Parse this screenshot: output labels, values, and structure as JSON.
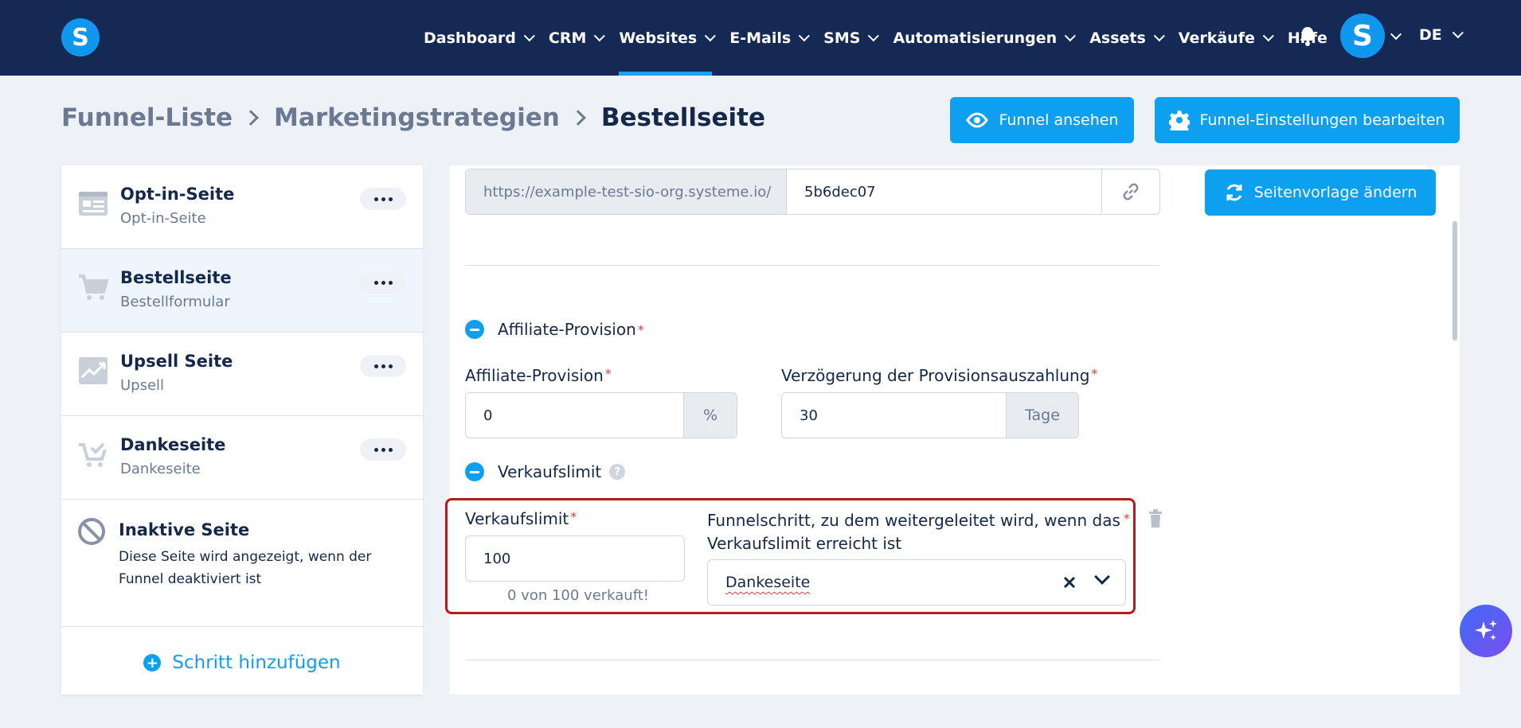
{
  "nav": {
    "logo_letter": "S",
    "items": [
      {
        "label": "Dashboard",
        "dropdown": true
      },
      {
        "label": "CRM",
        "dropdown": true
      },
      {
        "label": "Websites",
        "dropdown": true,
        "active": true
      },
      {
        "label": "E-Mails",
        "dropdown": true
      },
      {
        "label": "SMS",
        "dropdown": true
      },
      {
        "label": "Automatisierungen",
        "dropdown": true
      },
      {
        "label": "Assets",
        "dropdown": true
      },
      {
        "label": "Verkäufe",
        "dropdown": true
      },
      {
        "label": "Hilfe",
        "dropdown": false
      }
    ],
    "avatar_letter": "S",
    "language": "DE"
  },
  "breadcrumb": {
    "items": [
      "Funnel-Liste",
      "Marketingstrategien",
      "Bestellseite"
    ]
  },
  "header_buttons": {
    "view_funnel": "Funnel ansehen",
    "edit_settings": "Funnel-Einstellungen bearbeiten"
  },
  "sidebar": {
    "steps": [
      {
        "title": "Opt-in-Seite",
        "subtitle": "Opt-in-Seite",
        "icon": "optin-page-icon",
        "selected": false
      },
      {
        "title": "Bestellseite",
        "subtitle": "Bestellformular",
        "icon": "cart-icon",
        "selected": true
      },
      {
        "title": "Upsell Seite",
        "subtitle": "Upsell",
        "icon": "upsell-chart-icon",
        "selected": false
      },
      {
        "title": "Dankeseite",
        "subtitle": "Dankeseite",
        "icon": "cart-check-icon",
        "selected": false
      }
    ],
    "inactive": {
      "title": "Inaktive Seite",
      "description": "Diese Seite wird angezeigt, wenn der Funnel deaktiviert ist"
    },
    "add_step": "Schritt hinzufügen"
  },
  "main": {
    "url_prefix": "https://example-test-sio-org.systeme.io/",
    "url_slug": "5b6dec07",
    "change_template": "Seitenvorlage ändern",
    "affiliate_section": "Affiliate-Provision",
    "affiliate_label": "Affiliate-Provision",
    "affiliate_value": "0",
    "affiliate_suffix": "%",
    "delay_label": "Verzögerung der Provisionsauszahlung",
    "delay_value": "30",
    "delay_suffix": "Tage",
    "sales_limit_section": "Verkaufslimit",
    "sales_limit_label": "Verkaufslimit",
    "sales_limit_value": "100",
    "sales_limit_hint": "0 von 100 verkauft!",
    "redirect_label_line1": "Funnelschritt, zu dem weitergeleitet wird, wenn das",
    "redirect_label_line2": "Verkaufslimit erreicht ist",
    "redirect_value": "Dankeseite",
    "required_mark": "*",
    "help_mark": "?"
  },
  "colors": {
    "nav_bg": "#142a55",
    "accent": "#0ea0f0",
    "highlight": "#b71c1c"
  }
}
